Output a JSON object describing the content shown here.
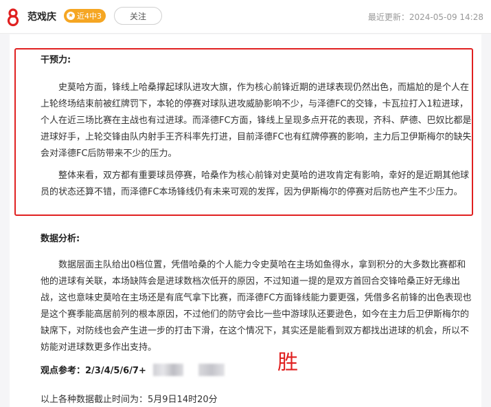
{
  "header": {
    "author": "范戏庆",
    "badge": "近4中3",
    "follow_label": "关注",
    "last_update": "最近更新：2024-05-09 14:28"
  },
  "article": {
    "section1_heading": "干预力:",
    "section1_p1": "史莫哈方面，锋线上哈桑撑起球队进攻大旗，作为核心前锋近期的进球表现仍然出色，而尴尬的是个人在上轮终场结束前被红牌罚下，本轮的停赛对球队进攻威胁影响不少，与泽德FC的交锋，卡瓦拉打入1粒进球，个人在近三场比赛在主战也有过进球。而泽德FC方面，锋线上呈现多点开花的表现，齐科、萨德、巴奴比都是进球好手，上轮交锋由队内射手王齐科率先打进，目前泽德FC也有红牌停赛的影响，主力后卫伊斯梅尔的缺失会对泽德FC后防带来不少的压力。",
    "section1_p2": "整体来看，双方都有重要球员停赛，哈桑作为核心前锋对史莫哈的进攻肯定有影响，幸好的是近期其他球员的状态还算不错，而泽德FC本场锋线仍有未来可观的发挥，因为伊斯梅尔的停赛对后防也产生不少压力。",
    "section2_heading": "数据分析:",
    "section2_p1": "数据层面主队给出0档位置，凭借哈桑的个人能力令史莫哈在主场如鱼得水，拿到积分的大多数比赛都和他的进球有关联，本场缺阵会是进球数档次低开的原因，不过知道一提的是双方首回合交锋哈桑正好无缘出战，这也意味史莫哈在主场还是有底气拿下比赛，而泽德FC方面锋线能力要更强，凭借多名前锋的出色表现也是这个赛季能高居前列的根本原因，不过他们的防守会比一些中游球队还要逊色，如今在主力后卫伊斯梅尔的缺席下，对防线也会产生进一步的打击下滑，在这个情况下，其实还是能看到双方都找出进球的机会，所以不妨能对进球数更多作出支持。",
    "reference_label": "观点参考：2/3/4/5/6/7+",
    "win_mark": "胜",
    "footer_note": "以上各种数据截止时间为：5月9日14时20分"
  },
  "colors": {
    "accent_red": "#e02020",
    "badge_orange": "#f5a623"
  }
}
